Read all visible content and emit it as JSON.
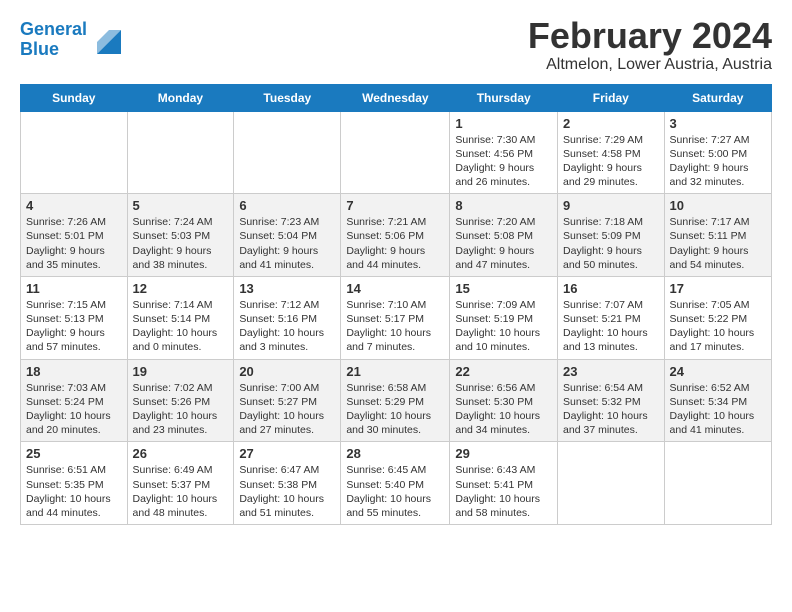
{
  "header": {
    "logo_line1": "General",
    "logo_line2": "Blue",
    "title": "February 2024",
    "subtitle": "Altmelon, Lower Austria, Austria"
  },
  "days_of_week": [
    "Sunday",
    "Monday",
    "Tuesday",
    "Wednesday",
    "Thursday",
    "Friday",
    "Saturday"
  ],
  "weeks": [
    [
      {
        "num": "",
        "info": ""
      },
      {
        "num": "",
        "info": ""
      },
      {
        "num": "",
        "info": ""
      },
      {
        "num": "",
        "info": ""
      },
      {
        "num": "1",
        "info": "Sunrise: 7:30 AM\nSunset: 4:56 PM\nDaylight: 9 hours\nand 26 minutes."
      },
      {
        "num": "2",
        "info": "Sunrise: 7:29 AM\nSunset: 4:58 PM\nDaylight: 9 hours\nand 29 minutes."
      },
      {
        "num": "3",
        "info": "Sunrise: 7:27 AM\nSunset: 5:00 PM\nDaylight: 9 hours\nand 32 minutes."
      }
    ],
    [
      {
        "num": "4",
        "info": "Sunrise: 7:26 AM\nSunset: 5:01 PM\nDaylight: 9 hours\nand 35 minutes."
      },
      {
        "num": "5",
        "info": "Sunrise: 7:24 AM\nSunset: 5:03 PM\nDaylight: 9 hours\nand 38 minutes."
      },
      {
        "num": "6",
        "info": "Sunrise: 7:23 AM\nSunset: 5:04 PM\nDaylight: 9 hours\nand 41 minutes."
      },
      {
        "num": "7",
        "info": "Sunrise: 7:21 AM\nSunset: 5:06 PM\nDaylight: 9 hours\nand 44 minutes."
      },
      {
        "num": "8",
        "info": "Sunrise: 7:20 AM\nSunset: 5:08 PM\nDaylight: 9 hours\nand 47 minutes."
      },
      {
        "num": "9",
        "info": "Sunrise: 7:18 AM\nSunset: 5:09 PM\nDaylight: 9 hours\nand 50 minutes."
      },
      {
        "num": "10",
        "info": "Sunrise: 7:17 AM\nSunset: 5:11 PM\nDaylight: 9 hours\nand 54 minutes."
      }
    ],
    [
      {
        "num": "11",
        "info": "Sunrise: 7:15 AM\nSunset: 5:13 PM\nDaylight: 9 hours\nand 57 minutes."
      },
      {
        "num": "12",
        "info": "Sunrise: 7:14 AM\nSunset: 5:14 PM\nDaylight: 10 hours\nand 0 minutes."
      },
      {
        "num": "13",
        "info": "Sunrise: 7:12 AM\nSunset: 5:16 PM\nDaylight: 10 hours\nand 3 minutes."
      },
      {
        "num": "14",
        "info": "Sunrise: 7:10 AM\nSunset: 5:17 PM\nDaylight: 10 hours\nand 7 minutes."
      },
      {
        "num": "15",
        "info": "Sunrise: 7:09 AM\nSunset: 5:19 PM\nDaylight: 10 hours\nand 10 minutes."
      },
      {
        "num": "16",
        "info": "Sunrise: 7:07 AM\nSunset: 5:21 PM\nDaylight: 10 hours\nand 13 minutes."
      },
      {
        "num": "17",
        "info": "Sunrise: 7:05 AM\nSunset: 5:22 PM\nDaylight: 10 hours\nand 17 minutes."
      }
    ],
    [
      {
        "num": "18",
        "info": "Sunrise: 7:03 AM\nSunset: 5:24 PM\nDaylight: 10 hours\nand 20 minutes."
      },
      {
        "num": "19",
        "info": "Sunrise: 7:02 AM\nSunset: 5:26 PM\nDaylight: 10 hours\nand 23 minutes."
      },
      {
        "num": "20",
        "info": "Sunrise: 7:00 AM\nSunset: 5:27 PM\nDaylight: 10 hours\nand 27 minutes."
      },
      {
        "num": "21",
        "info": "Sunrise: 6:58 AM\nSunset: 5:29 PM\nDaylight: 10 hours\nand 30 minutes."
      },
      {
        "num": "22",
        "info": "Sunrise: 6:56 AM\nSunset: 5:30 PM\nDaylight: 10 hours\nand 34 minutes."
      },
      {
        "num": "23",
        "info": "Sunrise: 6:54 AM\nSunset: 5:32 PM\nDaylight: 10 hours\nand 37 minutes."
      },
      {
        "num": "24",
        "info": "Sunrise: 6:52 AM\nSunset: 5:34 PM\nDaylight: 10 hours\nand 41 minutes."
      }
    ],
    [
      {
        "num": "25",
        "info": "Sunrise: 6:51 AM\nSunset: 5:35 PM\nDaylight: 10 hours\nand 44 minutes."
      },
      {
        "num": "26",
        "info": "Sunrise: 6:49 AM\nSunset: 5:37 PM\nDaylight: 10 hours\nand 48 minutes."
      },
      {
        "num": "27",
        "info": "Sunrise: 6:47 AM\nSunset: 5:38 PM\nDaylight: 10 hours\nand 51 minutes."
      },
      {
        "num": "28",
        "info": "Sunrise: 6:45 AM\nSunset: 5:40 PM\nDaylight: 10 hours\nand 55 minutes."
      },
      {
        "num": "29",
        "info": "Sunrise: 6:43 AM\nSunset: 5:41 PM\nDaylight: 10 hours\nand 58 minutes."
      },
      {
        "num": "",
        "info": ""
      },
      {
        "num": "",
        "info": ""
      }
    ]
  ]
}
